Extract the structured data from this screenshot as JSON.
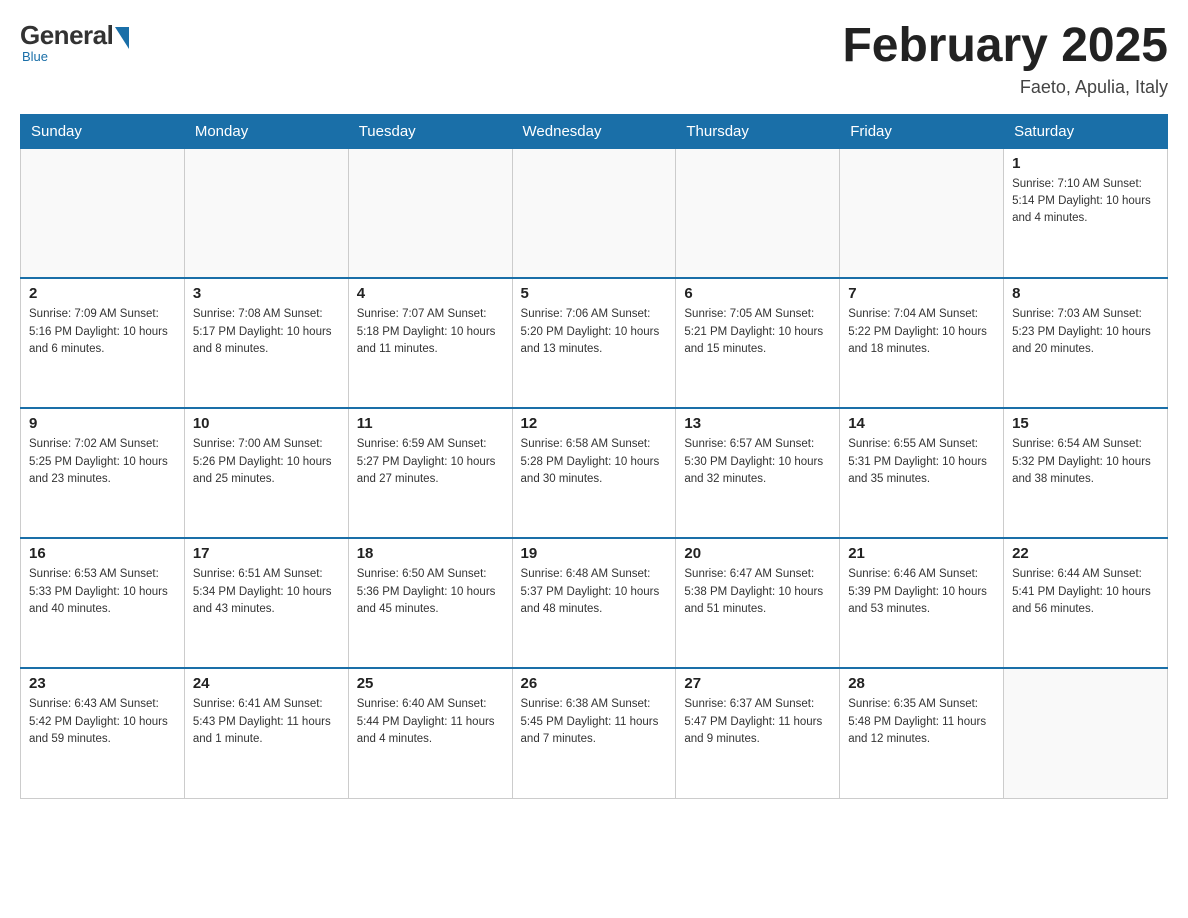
{
  "logo": {
    "general": "General",
    "blue": "Blue",
    "subtitle": "Blue"
  },
  "title": {
    "month": "February 2025",
    "location": "Faeto, Apulia, Italy"
  },
  "weekdays": [
    "Sunday",
    "Monday",
    "Tuesday",
    "Wednesday",
    "Thursday",
    "Friday",
    "Saturday"
  ],
  "weeks": [
    [
      {
        "day": "",
        "info": ""
      },
      {
        "day": "",
        "info": ""
      },
      {
        "day": "",
        "info": ""
      },
      {
        "day": "",
        "info": ""
      },
      {
        "day": "",
        "info": ""
      },
      {
        "day": "",
        "info": ""
      },
      {
        "day": "1",
        "info": "Sunrise: 7:10 AM\nSunset: 5:14 PM\nDaylight: 10 hours and 4 minutes."
      }
    ],
    [
      {
        "day": "2",
        "info": "Sunrise: 7:09 AM\nSunset: 5:16 PM\nDaylight: 10 hours and 6 minutes."
      },
      {
        "day": "3",
        "info": "Sunrise: 7:08 AM\nSunset: 5:17 PM\nDaylight: 10 hours and 8 minutes."
      },
      {
        "day": "4",
        "info": "Sunrise: 7:07 AM\nSunset: 5:18 PM\nDaylight: 10 hours and 11 minutes."
      },
      {
        "day": "5",
        "info": "Sunrise: 7:06 AM\nSunset: 5:20 PM\nDaylight: 10 hours and 13 minutes."
      },
      {
        "day": "6",
        "info": "Sunrise: 7:05 AM\nSunset: 5:21 PM\nDaylight: 10 hours and 15 minutes."
      },
      {
        "day": "7",
        "info": "Sunrise: 7:04 AM\nSunset: 5:22 PM\nDaylight: 10 hours and 18 minutes."
      },
      {
        "day": "8",
        "info": "Sunrise: 7:03 AM\nSunset: 5:23 PM\nDaylight: 10 hours and 20 minutes."
      }
    ],
    [
      {
        "day": "9",
        "info": "Sunrise: 7:02 AM\nSunset: 5:25 PM\nDaylight: 10 hours and 23 minutes."
      },
      {
        "day": "10",
        "info": "Sunrise: 7:00 AM\nSunset: 5:26 PM\nDaylight: 10 hours and 25 minutes."
      },
      {
        "day": "11",
        "info": "Sunrise: 6:59 AM\nSunset: 5:27 PM\nDaylight: 10 hours and 27 minutes."
      },
      {
        "day": "12",
        "info": "Sunrise: 6:58 AM\nSunset: 5:28 PM\nDaylight: 10 hours and 30 minutes."
      },
      {
        "day": "13",
        "info": "Sunrise: 6:57 AM\nSunset: 5:30 PM\nDaylight: 10 hours and 32 minutes."
      },
      {
        "day": "14",
        "info": "Sunrise: 6:55 AM\nSunset: 5:31 PM\nDaylight: 10 hours and 35 minutes."
      },
      {
        "day": "15",
        "info": "Sunrise: 6:54 AM\nSunset: 5:32 PM\nDaylight: 10 hours and 38 minutes."
      }
    ],
    [
      {
        "day": "16",
        "info": "Sunrise: 6:53 AM\nSunset: 5:33 PM\nDaylight: 10 hours and 40 minutes."
      },
      {
        "day": "17",
        "info": "Sunrise: 6:51 AM\nSunset: 5:34 PM\nDaylight: 10 hours and 43 minutes."
      },
      {
        "day": "18",
        "info": "Sunrise: 6:50 AM\nSunset: 5:36 PM\nDaylight: 10 hours and 45 minutes."
      },
      {
        "day": "19",
        "info": "Sunrise: 6:48 AM\nSunset: 5:37 PM\nDaylight: 10 hours and 48 minutes."
      },
      {
        "day": "20",
        "info": "Sunrise: 6:47 AM\nSunset: 5:38 PM\nDaylight: 10 hours and 51 minutes."
      },
      {
        "day": "21",
        "info": "Sunrise: 6:46 AM\nSunset: 5:39 PM\nDaylight: 10 hours and 53 minutes."
      },
      {
        "day": "22",
        "info": "Sunrise: 6:44 AM\nSunset: 5:41 PM\nDaylight: 10 hours and 56 minutes."
      }
    ],
    [
      {
        "day": "23",
        "info": "Sunrise: 6:43 AM\nSunset: 5:42 PM\nDaylight: 10 hours and 59 minutes."
      },
      {
        "day": "24",
        "info": "Sunrise: 6:41 AM\nSunset: 5:43 PM\nDaylight: 11 hours and 1 minute."
      },
      {
        "day": "25",
        "info": "Sunrise: 6:40 AM\nSunset: 5:44 PM\nDaylight: 11 hours and 4 minutes."
      },
      {
        "day": "26",
        "info": "Sunrise: 6:38 AM\nSunset: 5:45 PM\nDaylight: 11 hours and 7 minutes."
      },
      {
        "day": "27",
        "info": "Sunrise: 6:37 AM\nSunset: 5:47 PM\nDaylight: 11 hours and 9 minutes."
      },
      {
        "day": "28",
        "info": "Sunrise: 6:35 AM\nSunset: 5:48 PM\nDaylight: 11 hours and 12 minutes."
      },
      {
        "day": "",
        "info": ""
      }
    ]
  ]
}
